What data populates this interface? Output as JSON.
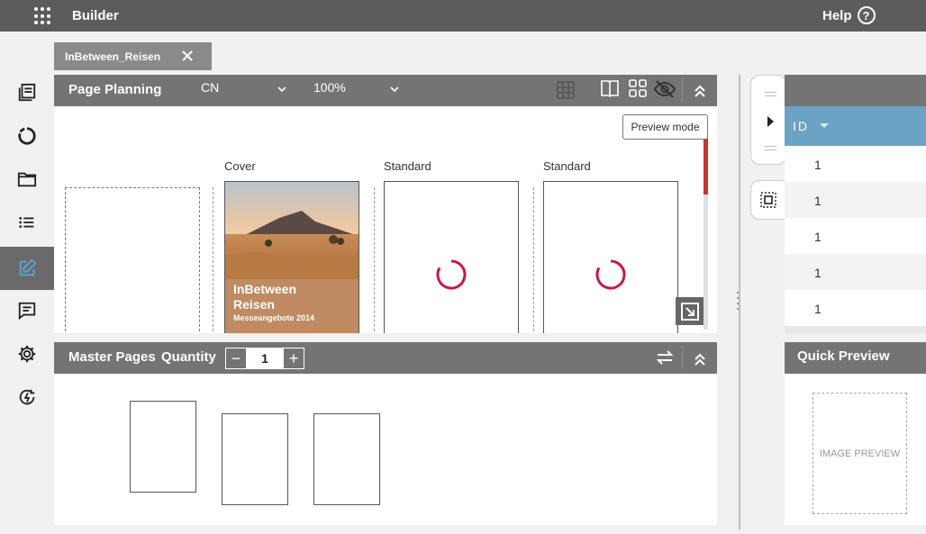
{
  "app": {
    "title": "Builder",
    "help_label": "Help"
  },
  "document_tab": {
    "label": "InBetween_Reisen"
  },
  "page_planning": {
    "title": "Page Planning",
    "language": "CN",
    "zoom": "100%",
    "tooltip": "Preview mode",
    "pages": [
      {
        "label": ""
      },
      {
        "label": "Cover",
        "cover_title": "InBetween Reisen",
        "cover_title_line1": "InBetween",
        "cover_title_line2": "Reisen",
        "cover_subtitle": "Messeangebote 2014"
      },
      {
        "label": "Standard"
      },
      {
        "label": "Standard"
      }
    ]
  },
  "master_pages": {
    "title": "Master Pages",
    "quantity_label": "Quantity",
    "quantity_value": "1",
    "minus": "−",
    "plus": "+"
  },
  "table": {
    "column_header": "ID",
    "rows": [
      "1",
      "1",
      "1",
      "1",
      "1"
    ]
  },
  "quick_preview": {
    "title": "Quick Preview",
    "placeholder": "IMAGE PREVIEW"
  },
  "sidebar": {
    "items": [
      {
        "icon": "library-icon",
        "active": false
      },
      {
        "icon": "circle-icon",
        "active": false
      },
      {
        "icon": "folder-icon",
        "active": false
      },
      {
        "icon": "list-icon",
        "active": false
      },
      {
        "icon": "edit-icon",
        "active": true
      },
      {
        "icon": "comment-icon",
        "active": false
      },
      {
        "icon": "gear-icon",
        "active": false
      },
      {
        "icon": "sync-icon",
        "active": false
      }
    ]
  },
  "colors": {
    "topbar": "#5c5c5c",
    "panel_header": "#747474",
    "id_header": "#6ba3c4",
    "spinner": "#c8174a",
    "active_icon": "#5aa6d6"
  }
}
